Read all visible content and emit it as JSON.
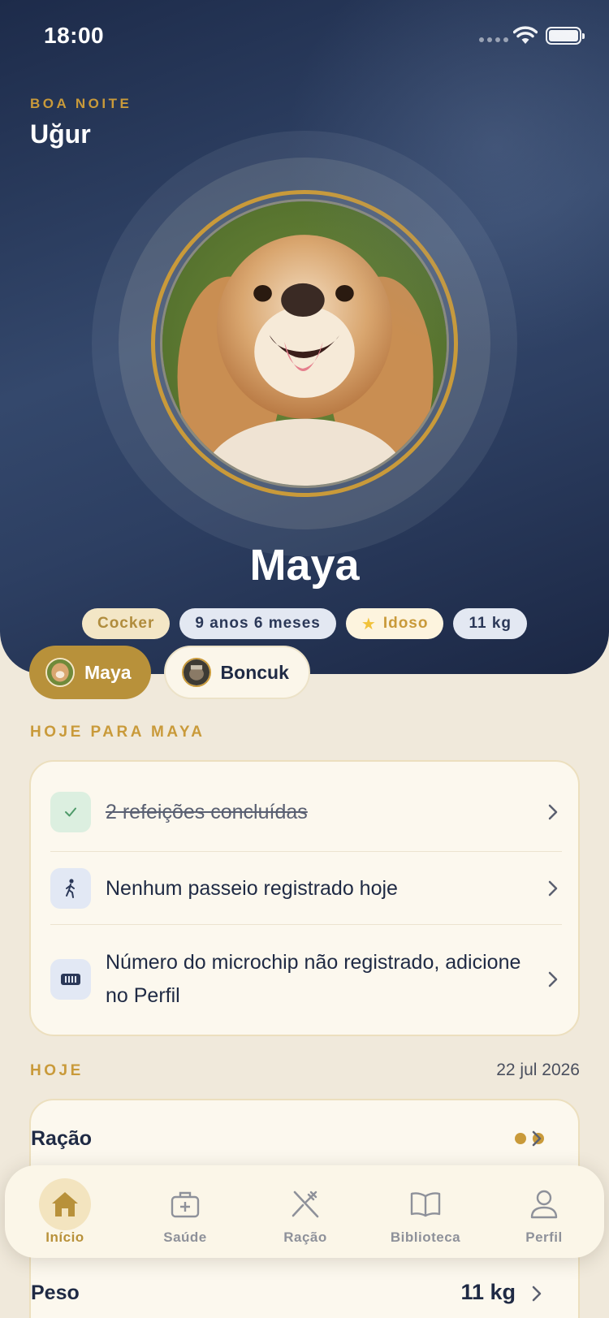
{
  "status_bar": {
    "time": "18:00"
  },
  "header": {
    "greeting": "BOA NOITE",
    "user_name": "Uğur",
    "pet_name": "Maya",
    "chips": {
      "breed": "Cocker",
      "age": "9 anos 6 meses",
      "senior": "Idoso",
      "weight": "11 kg"
    }
  },
  "pet_tabs": [
    {
      "label": "Maya",
      "active": true
    },
    {
      "label": "Boncuk",
      "active": false
    }
  ],
  "today_for_pet": {
    "section_title": "HOJE PARA MAYA",
    "tasks": [
      {
        "text": "2 refeições concluídas",
        "done": true,
        "icon": "check-icon"
      },
      {
        "text": "Nenhum passeio registrado hoje",
        "done": false,
        "icon": "walking-icon"
      },
      {
        "text": "Número do microchip não registrado, adicione no Perfil",
        "done": false,
        "icon": "microchip-icon"
      }
    ]
  },
  "today": {
    "section_title": "HOJE",
    "date": "22 jul 2026",
    "rows": [
      {
        "title": "Ração",
        "value": ""
      },
      {
        "title": "Peso",
        "value": "11 kg"
      }
    ]
  },
  "tabbar": [
    {
      "label": "Início",
      "icon": "home-icon",
      "active": true
    },
    {
      "label": "Saúde",
      "icon": "medical-kit-icon",
      "active": false
    },
    {
      "label": "Ração",
      "icon": "fork-knife-icon",
      "active": false
    },
    {
      "label": "Biblioteca",
      "icon": "book-icon",
      "active": false
    },
    {
      "label": "Perfil",
      "icon": "person-icon",
      "active": false
    }
  ],
  "colors": {
    "accent_gold": "#c99a3a",
    "navy": "#1d2b4a",
    "background": "#f0e9db"
  }
}
